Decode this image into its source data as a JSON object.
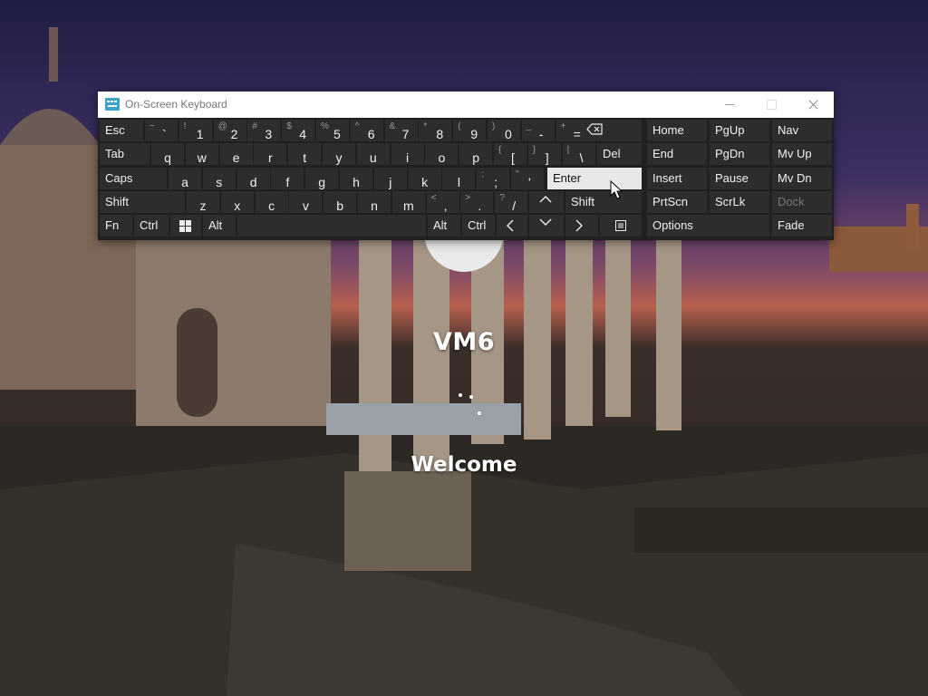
{
  "background": {
    "description_colors": {
      "sky_top": "#222042",
      "sky_mid": "#4a3a6a",
      "horizon": "#c0664a",
      "ground": "#2f2a24"
    }
  },
  "welcome": {
    "machine_name": "VM6",
    "status": "Welcome"
  },
  "osk": {
    "title": "On-Screen Keyboard",
    "icon": "keyboard-icon",
    "row1": [
      {
        "id": "esc",
        "label": "Esc"
      },
      {
        "id": "tilde",
        "shift": "~",
        "main": "`"
      },
      {
        "id": "1",
        "shift": "!",
        "main": "1"
      },
      {
        "id": "2",
        "shift": "@",
        "main": "2"
      },
      {
        "id": "3",
        "shift": "#",
        "main": "3"
      },
      {
        "id": "4",
        "shift": "$",
        "main": "4"
      },
      {
        "id": "5",
        "shift": "%",
        "main": "5"
      },
      {
        "id": "6",
        "shift": "^",
        "main": "6"
      },
      {
        "id": "7",
        "shift": "&",
        "main": "7"
      },
      {
        "id": "8",
        "shift": "*",
        "main": "8"
      },
      {
        "id": "9",
        "shift": "(",
        "main": "9"
      },
      {
        "id": "0",
        "shift": ")",
        "main": "0"
      },
      {
        "id": "minus",
        "shift": "_",
        "main": "-"
      },
      {
        "id": "equals",
        "shift": "+",
        "main": "="
      }
    ],
    "row2": [
      {
        "id": "tab",
        "label": "Tab"
      },
      {
        "id": "q",
        "label": "q"
      },
      {
        "id": "w",
        "label": "w"
      },
      {
        "id": "e",
        "label": "e"
      },
      {
        "id": "r",
        "label": "r"
      },
      {
        "id": "t",
        "label": "t"
      },
      {
        "id": "y",
        "label": "y"
      },
      {
        "id": "u",
        "label": "u"
      },
      {
        "id": "i",
        "label": "i"
      },
      {
        "id": "o",
        "label": "o"
      },
      {
        "id": "p",
        "label": "p"
      },
      {
        "id": "lbracket",
        "shift": "{",
        "main": "["
      },
      {
        "id": "rbracket",
        "shift": "}",
        "main": "]"
      },
      {
        "id": "backslash",
        "shift": "|",
        "main": "\\"
      },
      {
        "id": "del",
        "label": "Del"
      }
    ],
    "row3": [
      {
        "id": "caps",
        "label": "Caps"
      },
      {
        "id": "a",
        "label": "a"
      },
      {
        "id": "s",
        "label": "s"
      },
      {
        "id": "d",
        "label": "d"
      },
      {
        "id": "f",
        "label": "f"
      },
      {
        "id": "g",
        "label": "g"
      },
      {
        "id": "h",
        "label": "h"
      },
      {
        "id": "j",
        "label": "j"
      },
      {
        "id": "k",
        "label": "k"
      },
      {
        "id": "l",
        "label": "l"
      },
      {
        "id": "semicolon",
        "shift": ":",
        "main": ";"
      },
      {
        "id": "quote",
        "shift": "\"",
        "main": "'"
      },
      {
        "id": "enter",
        "label": "Enter"
      }
    ],
    "row4": [
      {
        "id": "lshift",
        "label": "Shift"
      },
      {
        "id": "z",
        "label": "z"
      },
      {
        "id": "x",
        "label": "x"
      },
      {
        "id": "c",
        "label": "c"
      },
      {
        "id": "v",
        "label": "v"
      },
      {
        "id": "b",
        "label": "b"
      },
      {
        "id": "n",
        "label": "n"
      },
      {
        "id": "m",
        "label": "m"
      },
      {
        "id": "comma",
        "shift": "<",
        "main": ","
      },
      {
        "id": "period",
        "shift": ">",
        "main": "."
      },
      {
        "id": "slash",
        "shift": "?",
        "main": "/"
      },
      {
        "id": "rshift",
        "label": "Shift"
      }
    ],
    "row5": [
      {
        "id": "fn",
        "label": "Fn"
      },
      {
        "id": "lctrl",
        "label": "Ctrl"
      },
      {
        "id": "lalt",
        "label": "Alt"
      },
      {
        "id": "ralt",
        "label": "Alt"
      },
      {
        "id": "rctrl",
        "label": "Ctrl"
      }
    ],
    "nav": [
      {
        "id": "home",
        "label": "Home"
      },
      {
        "id": "pgup",
        "label": "PgUp"
      },
      {
        "id": "navk",
        "label": "Nav"
      },
      {
        "id": "end",
        "label": "End"
      },
      {
        "id": "pgdn",
        "label": "PgDn"
      },
      {
        "id": "mvup",
        "label": "Mv Up"
      },
      {
        "id": "insert",
        "label": "Insert"
      },
      {
        "id": "pause",
        "label": "Pause"
      },
      {
        "id": "mvdn",
        "label": "Mv Dn"
      },
      {
        "id": "prtscn",
        "label": "PrtScn"
      },
      {
        "id": "scrlk",
        "label": "ScrLk"
      },
      {
        "id": "dock",
        "label": "Dock"
      },
      {
        "id": "options",
        "label": "Options"
      },
      {
        "id": "fade",
        "label": "Fade"
      }
    ]
  }
}
